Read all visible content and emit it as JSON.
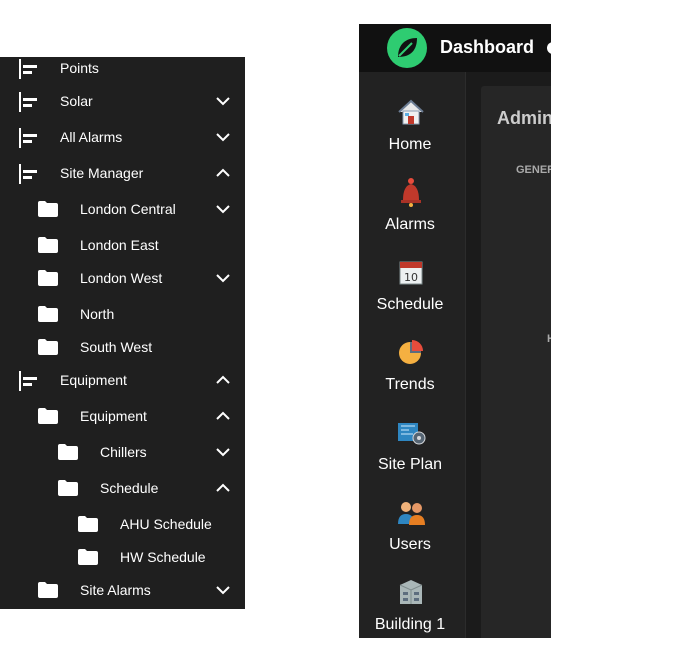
{
  "tree": {
    "items": [
      {
        "label": "Points",
        "level": 0,
        "type": "list",
        "chevron": "none"
      },
      {
        "label": "Solar",
        "level": 0,
        "type": "list",
        "chevron": "down"
      },
      {
        "label": "All Alarms",
        "level": 0,
        "type": "list",
        "chevron": "down"
      },
      {
        "label": "Site Manager",
        "level": 0,
        "type": "list",
        "chevron": "up"
      },
      {
        "label": "London Central",
        "level": 1,
        "type": "folder",
        "chevron": "down"
      },
      {
        "label": "London East",
        "level": 1,
        "type": "folder",
        "chevron": "none"
      },
      {
        "label": "London West",
        "level": 1,
        "type": "folder",
        "chevron": "down"
      },
      {
        "label": "North",
        "level": 1,
        "type": "folder",
        "chevron": "none"
      },
      {
        "label": "South West",
        "level": 1,
        "type": "folder",
        "chevron": "none"
      },
      {
        "label": "Equipment",
        "level": 0,
        "type": "list",
        "chevron": "up"
      },
      {
        "label": "Equipment",
        "level": 1,
        "type": "folder",
        "chevron": "up"
      },
      {
        "label": "Chillers",
        "level": 2,
        "type": "folder",
        "chevron": "down"
      },
      {
        "label": "Schedule",
        "level": 2,
        "type": "folder",
        "chevron": "up"
      },
      {
        "label": "AHU Schedule",
        "level": 3,
        "type": "folder",
        "chevron": "none"
      },
      {
        "label": "HW Schedule",
        "level": 3,
        "type": "folder",
        "chevron": "none"
      },
      {
        "label": "Site Alarms",
        "level": 1,
        "type": "folder",
        "chevron": "down"
      }
    ]
  },
  "dashboard": {
    "title": "Dashboard",
    "nav": [
      {
        "label": "Home",
        "icon": "home-icon"
      },
      {
        "label": "Alarms",
        "icon": "alarm-bell-icon"
      },
      {
        "label": "Schedule",
        "icon": "calendar-icon"
      },
      {
        "label": "Trends",
        "icon": "pie-chart-icon"
      },
      {
        "label": "Site Plan",
        "icon": "blueprint-icon"
      },
      {
        "label": "Users",
        "icon": "users-icon"
      },
      {
        "label": "Building 1",
        "icon": "building-icon"
      }
    ],
    "content": {
      "title": "Admin",
      "tab": "GENER",
      "fragment": "H"
    }
  },
  "colors": {
    "panel_bg": "#1f1f1f",
    "logo_green": "#2ecc71",
    "text": "#ffffff"
  }
}
